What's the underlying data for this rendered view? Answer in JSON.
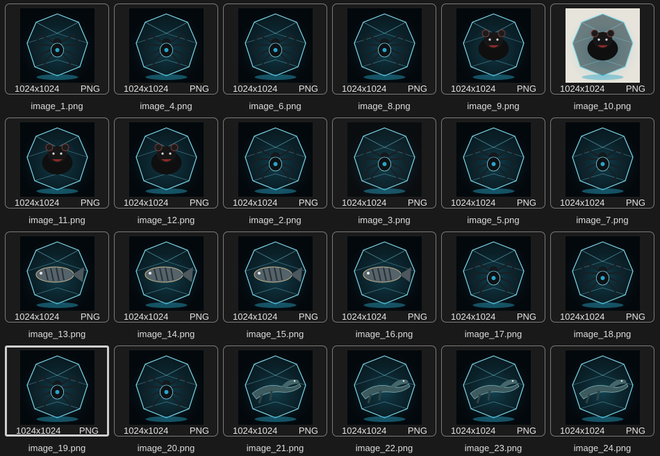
{
  "gallery": {
    "items": [
      {
        "name": "image_1.png",
        "dims": "1024x1024",
        "format": "PNG",
        "subject": "spider",
        "bg": "dark"
      },
      {
        "name": "image_4.png",
        "dims": "1024x1024",
        "format": "PNG",
        "subject": "spider",
        "bg": "dark"
      },
      {
        "name": "image_6.png",
        "dims": "1024x1024",
        "format": "PNG",
        "subject": "spider",
        "bg": "dark"
      },
      {
        "name": "image_8.png",
        "dims": "1024x1024",
        "format": "PNG",
        "subject": "spider",
        "bg": "dark"
      },
      {
        "name": "image_9.png",
        "dims": "1024x1024",
        "format": "PNG",
        "subject": "devil",
        "bg": "dark"
      },
      {
        "name": "image_10.png",
        "dims": "1024x1024",
        "format": "PNG",
        "subject": "devil",
        "bg": "light"
      },
      {
        "name": "image_11.png",
        "dims": "1024x1024",
        "format": "PNG",
        "subject": "devil",
        "bg": "dark"
      },
      {
        "name": "image_12.png",
        "dims": "1024x1024",
        "format": "PNG",
        "subject": "devil",
        "bg": "dark"
      },
      {
        "name": "image_2.png",
        "dims": "1024x1024",
        "format": "PNG",
        "subject": "spider",
        "bg": "dark"
      },
      {
        "name": "image_3.png",
        "dims": "1024x1024",
        "format": "PNG",
        "subject": "spider",
        "bg": "warm"
      },
      {
        "name": "image_5.png",
        "dims": "1024x1024",
        "format": "PNG",
        "subject": "spider",
        "bg": "dark"
      },
      {
        "name": "image_7.png",
        "dims": "1024x1024",
        "format": "PNG",
        "subject": "spider",
        "bg": "dark"
      },
      {
        "name": "image_13.png",
        "dims": "1024x1024",
        "format": "PNG",
        "subject": "fish",
        "bg": "dark"
      },
      {
        "name": "image_14.png",
        "dims": "1024x1024",
        "format": "PNG",
        "subject": "fish",
        "bg": "dark"
      },
      {
        "name": "image_15.png",
        "dims": "1024x1024",
        "format": "PNG",
        "subject": "fish",
        "bg": "dark"
      },
      {
        "name": "image_16.png",
        "dims": "1024x1024",
        "format": "PNG",
        "subject": "fish",
        "bg": "dark"
      },
      {
        "name": "image_17.png",
        "dims": "1024x1024",
        "format": "PNG",
        "subject": "spider",
        "bg": "dark"
      },
      {
        "name": "image_18.png",
        "dims": "1024x1024",
        "format": "PNG",
        "subject": "spider",
        "bg": "dark"
      },
      {
        "name": "image_19.png",
        "dims": "1024x1024",
        "format": "PNG",
        "subject": "spider",
        "bg": "dark"
      },
      {
        "name": "image_20.png",
        "dims": "1024x1024",
        "format": "PNG",
        "subject": "spider",
        "bg": "dark"
      },
      {
        "name": "image_21.png",
        "dims": "1024x1024",
        "format": "PNG",
        "subject": "lizard",
        "bg": "dark"
      },
      {
        "name": "image_22.png",
        "dims": "1024x1024",
        "format": "PNG",
        "subject": "lizard",
        "bg": "dark"
      },
      {
        "name": "image_23.png",
        "dims": "1024x1024",
        "format": "PNG",
        "subject": "lizard",
        "bg": "dark"
      },
      {
        "name": "image_24.png",
        "dims": "1024x1024",
        "format": "PNG",
        "subject": "lizard",
        "bg": "dark"
      }
    ],
    "selected_index": 18
  },
  "colors": {
    "background": "#191919",
    "card_border": "#7a7a7a",
    "selected_border": "#cfcfcf",
    "crystal": "#7fd8ea",
    "crystal_glow": "#2aa6c8"
  }
}
